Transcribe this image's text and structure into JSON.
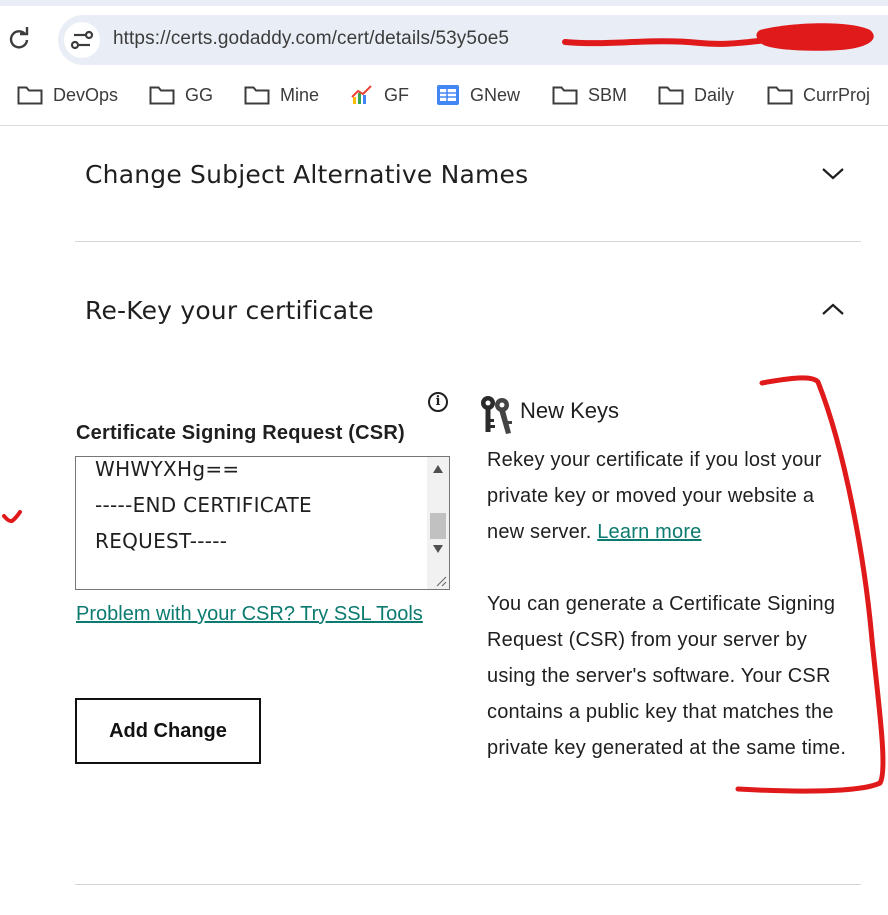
{
  "browser": {
    "url": "https://certs.godaddy.com/cert/details/53y5oe5",
    "bookmarks": [
      {
        "label": "DevOps",
        "icon": "folder-icon"
      },
      {
        "label": "GG",
        "icon": "folder-icon"
      },
      {
        "label": "Mine",
        "icon": "folder-icon"
      },
      {
        "label": "GF",
        "icon": "chart-favicon-icon"
      },
      {
        "label": "GNew",
        "icon": "google-sheets-icon"
      },
      {
        "label": "SBM",
        "icon": "folder-icon"
      },
      {
        "label": "Daily",
        "icon": "folder-icon"
      },
      {
        "label": "CurrProj",
        "icon": "folder-icon"
      }
    ]
  },
  "sections": {
    "san": {
      "title": "Change Subject Alternative Names",
      "state": "collapsed"
    },
    "rekey": {
      "title": "Re-Key your certificate",
      "state": "expanded"
    }
  },
  "csr": {
    "label": "Certificate Signing Request (CSR)",
    "value": "WHWYXHg==\n-----END CERTIFICATE\nREQUEST-----",
    "help_link": "Problem with your CSR? Try SSL Tools",
    "add_button": "Add Change"
  },
  "new_keys": {
    "title": "New Keys",
    "paragraph1": "Rekey your certificate if you lost your private key or moved your website a new server.",
    "learn_more": "Learn more",
    "paragraph2": "You can generate a Certificate Signing Request (CSR) from your server by using the server's software. Your CSR contains a public key that matches the private key generated at the same time."
  },
  "colors": {
    "link": "#0b7a6f",
    "annotation": "#e0191b",
    "omnibox": "#e9eef6"
  }
}
